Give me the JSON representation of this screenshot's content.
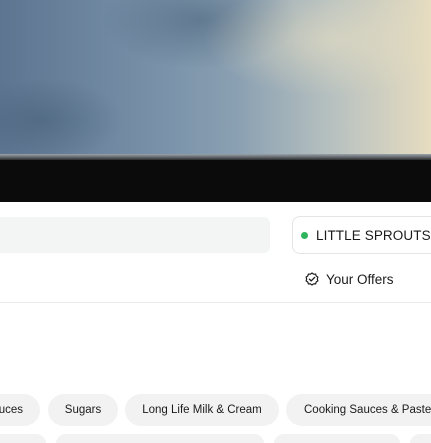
{
  "hero": {
    "icon": "hero-banner-photo"
  },
  "store": {
    "name": "LITTLE SPROUTS S",
    "status_color": "#2fb35c"
  },
  "offers": {
    "label": "Your Offers",
    "icon": "badge-check-icon"
  },
  "categories": [
    "uces",
    "Sugars",
    "Long Life Milk & Cream",
    "Cooking Sauces & Pastes"
  ]
}
